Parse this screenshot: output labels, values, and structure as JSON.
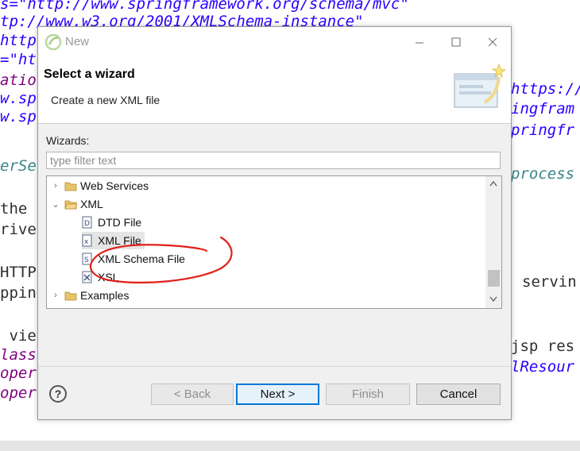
{
  "editor": {
    "lines": [
      {
        "text": "s=\"http://www.springframework.org/schema/mvc\"",
        "cls": "c-blue"
      },
      {
        "text": "tp://www.w3.org/2001/XMLSchema-instance\"",
        "cls": "c-blue"
      },
      {
        "text": "http",
        "cls": "c-blue"
      },
      {
        "text": "=\"ht",
        "cls": "c-blue"
      },
      {
        "text": "atio",
        "cls": "c-purple"
      },
      {
        "text": "w.sp",
        "cls": "c-blue"
      },
      {
        "text": "w.sp",
        "cls": "c-blue"
      },
      {
        "text": "erSe",
        "cls": "c-teal"
      },
      {
        "text": "the ",
        "cls": "c-dark"
      },
      {
        "text": "rive",
        "cls": "c-dark"
      },
      {
        "text": "HTTP",
        "cls": "c-dark"
      },
      {
        "text": "ppin",
        "cls": "c-dark"
      },
      {
        "text": " vie",
        "cls": "c-dark"
      },
      {
        "text": "lass",
        "cls": "c-purple"
      },
      {
        "text": "oper",
        "cls": "c-purple"
      },
      {
        "text": "oper",
        "cls": "c-purple"
      }
    ],
    "right_lines": [
      {
        "text": "https://",
        "cls": "c-blue"
      },
      {
        "text": "ingfram",
        "cls": "c-blue"
      },
      {
        "text": "pringfr",
        "cls": "c-blue"
      },
      {
        "text": "process",
        "cls": "c-teal"
      },
      {
        "text": "servin",
        "cls": "c-dark"
      },
      {
        "text": "jsp res",
        "cls": "c-dark"
      },
      {
        "text": "lResour",
        "cls": "c-blue"
      }
    ]
  },
  "dialog": {
    "title": "New",
    "banner_title": "Select a wizard",
    "banner_desc": "Create a new XML file",
    "wizards_label": "Wizards:",
    "filter_placeholder": "type filter text",
    "tree": [
      {
        "label": "Web Services",
        "kind": "folder",
        "expanded": false,
        "level": 0
      },
      {
        "label": "XML",
        "kind": "folder",
        "expanded": true,
        "level": 0
      },
      {
        "label": "DTD File",
        "kind": "file",
        "icon": "dtd-file-icon",
        "level": 1
      },
      {
        "label": "XML File",
        "kind": "file",
        "icon": "xml-file-icon",
        "level": 1,
        "selected": true
      },
      {
        "label": "XML Schema File",
        "kind": "file",
        "icon": "xml-schema-file-icon",
        "level": 1
      },
      {
        "label": "XSL",
        "kind": "file",
        "icon": "xsl-file-icon",
        "level": 1
      },
      {
        "label": "Examples",
        "kind": "folder",
        "expanded": false,
        "level": 0
      }
    ],
    "buttons": {
      "help": "?",
      "back": "< Back",
      "next": "Next >",
      "finish": "Finish",
      "cancel": "Cancel"
    }
  }
}
